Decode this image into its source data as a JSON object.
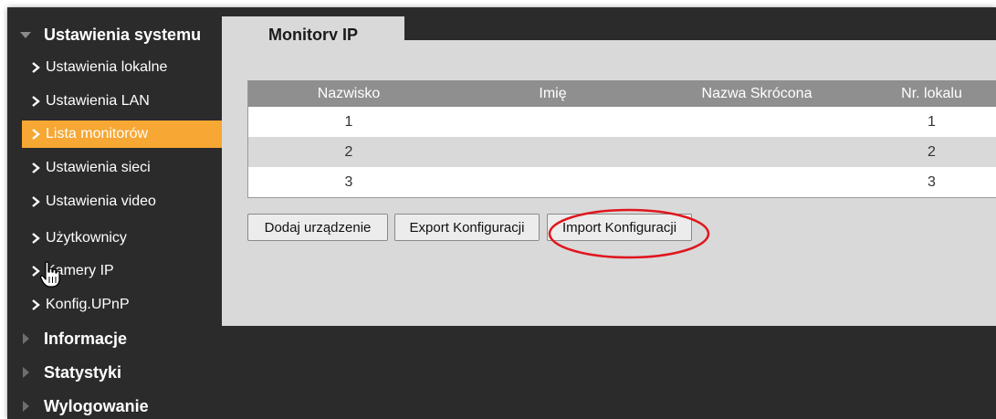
{
  "sidebar": {
    "sections": [
      {
        "label": "Ustawienia systemu",
        "expanded": true
      },
      {
        "label": "Informacje",
        "expanded": false
      },
      {
        "label": "Statystyki",
        "expanded": false
      },
      {
        "label": "Wylogowanie",
        "expanded": false
      }
    ],
    "items": [
      {
        "label": "Ustawienia lokalne",
        "active": false
      },
      {
        "label": "Ustawienia LAN",
        "active": false
      },
      {
        "label": "Lista monitorów",
        "active": true
      },
      {
        "label": "Ustawienia sieci",
        "active": false
      },
      {
        "label": "Ustawienia video",
        "active": false
      },
      {
        "label": "Użytkownicy",
        "active": false
      },
      {
        "label": "Kamery IP",
        "active": false
      },
      {
        "label": "Konfig.UPnP",
        "active": false
      }
    ]
  },
  "main": {
    "tab_label": "Monitory IP",
    "table": {
      "headers": [
        "Nazwisko",
        "Imię",
        "Nazwa Skrócona",
        "Nr. lokalu"
      ],
      "rows": [
        [
          "1",
          "",
          "",
          "1"
        ],
        [
          "2",
          "",
          "",
          "2"
        ],
        [
          "3",
          "",
          "",
          "3"
        ]
      ]
    },
    "buttons": {
      "add": "Dodaj urządzenie",
      "export": "Export Konfiguracji",
      "import": "Import Konfiguracji"
    }
  },
  "colors": {
    "background_dark": "#2b2b2b",
    "content_bg": "#d9d9d9",
    "active_item": "#f7a733",
    "table_header": "#8f8f8f",
    "annotation_circle": "#e0161e"
  },
  "icons": [
    "chevron-right-icon",
    "triangle-down-icon",
    "triangle-right-icon",
    "hand-cursor-icon"
  ]
}
